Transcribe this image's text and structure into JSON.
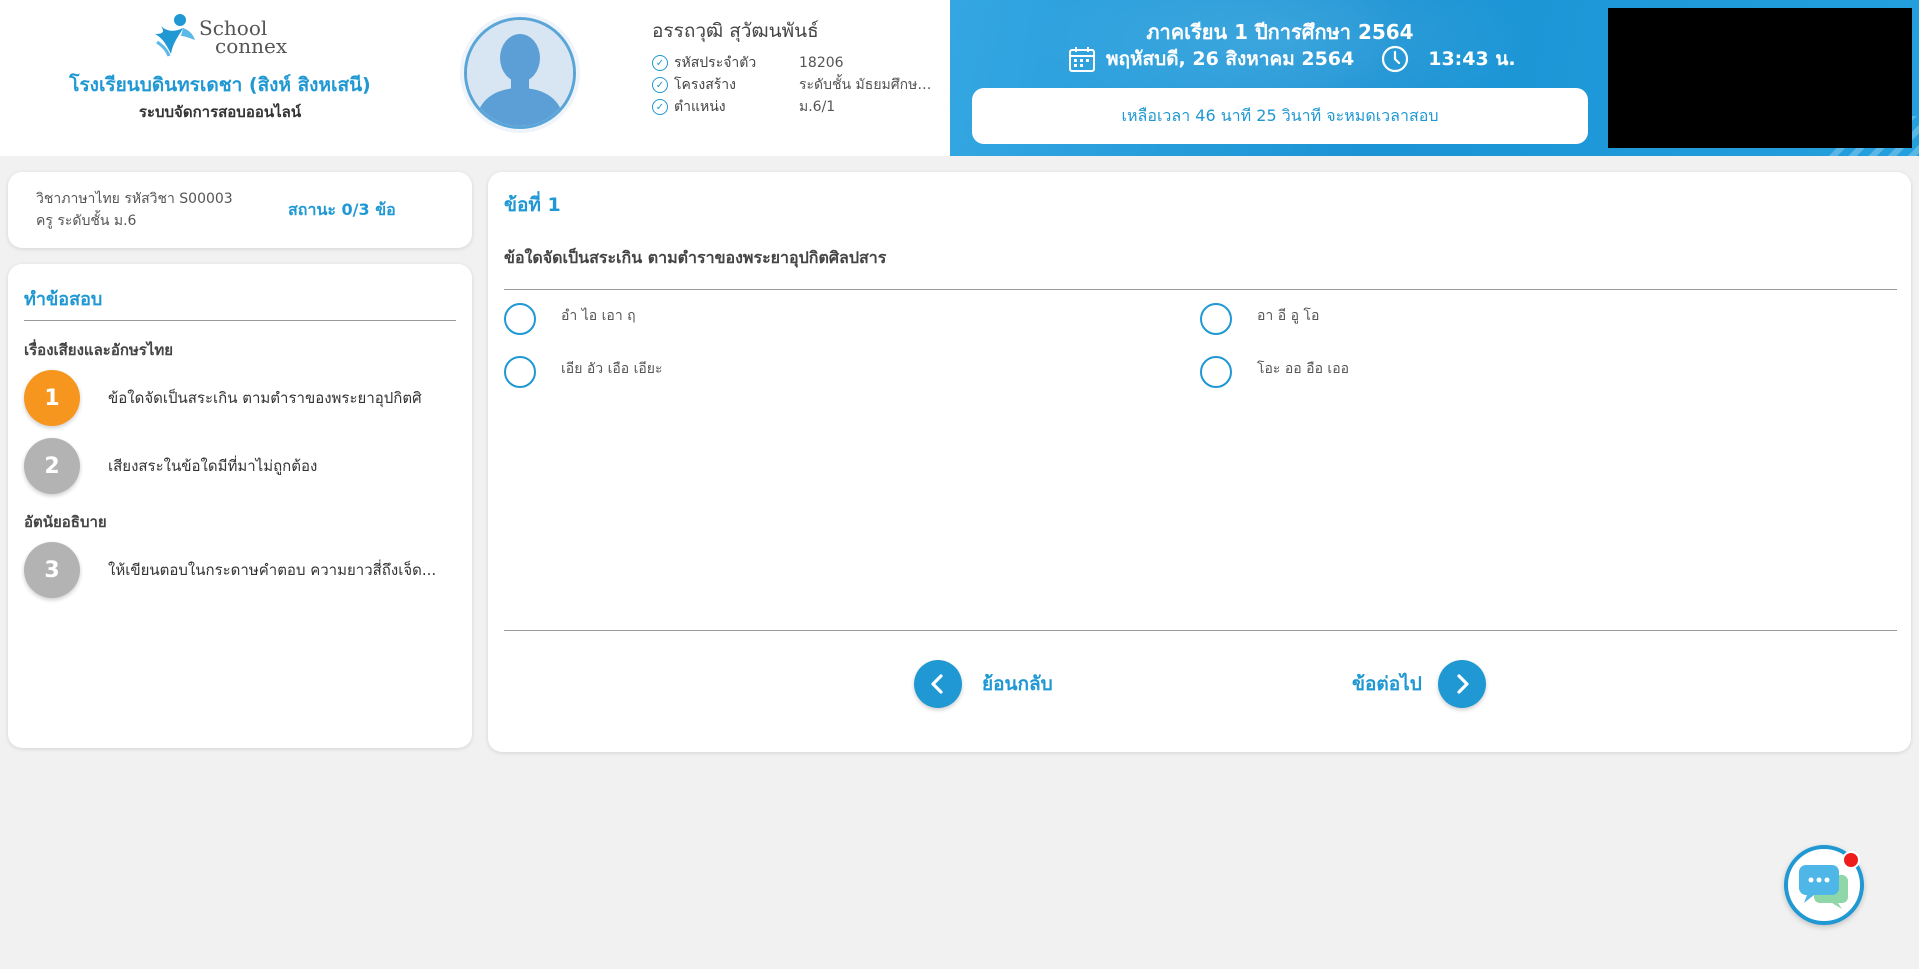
{
  "header": {
    "logo_line1": "School",
    "logo_line2": "connex",
    "school_name": "โรงเรียนบดินทรเดชา (สิงห์ สิงหเสนี)",
    "system_name": "ระบบจัดการสอบออนไลน์",
    "student_name": "อรรถวุฒิ สุวัฒนพันธ์",
    "info": [
      {
        "label": "รหัสประจำตัว",
        "value": "18206"
      },
      {
        "label": "โครงสร้าง",
        "value": "ระดับชั้น มัธยมศึกษา..."
      },
      {
        "label": "ตำแหน่ง",
        "value": "ม.6/1"
      }
    ],
    "term": "ภาคเรียน 1 ปีการศึกษา 2564",
    "date": "พฤหัสบดี, 26 สิงหาคม 2564",
    "time": "13:43 น.",
    "countdown": "เหลือเวลา 46 นาที 25 วินาที จะหมดเวลาสอบ"
  },
  "subject": {
    "line1": "วิชาภาษาไทย รหัสวิชา S00003",
    "line2": "ครู ระดับชั้น ม.6",
    "status": "สถานะ 0/3 ข้อ"
  },
  "nav": {
    "title": "ทำข้อสอบ",
    "section1": "เรื่องเสียงและอักษรไทย",
    "section2": "อัตนัยอธิบาย",
    "questions": [
      {
        "num": "1",
        "text": "ข้อใดจัดเป็นสระเกิน ตามตำราของพระยาอุปกิตศิ"
      },
      {
        "num": "2",
        "text": "เสียงสระในข้อใดมีที่มาไม่ถูกต้อง"
      },
      {
        "num": "3",
        "text": "ให้เขียนตอบในกระดาษคำตอบ ความยาวสี่ถึงเจ็ด..."
      }
    ]
  },
  "question": {
    "heading": "ข้อที่ 1",
    "prompt": "ข้อใดจัดเป็นสระเกิน ตามตำราของพระยาอุปกิตศิลปสาร",
    "choices": [
      "อำ ไอ เอา ฤ",
      "อา อี อู โอ",
      "เอีย อัว เอือ เอียะ",
      "โอะ ออ อือ เออ"
    ],
    "prev_label": "ย้อนกลับ",
    "next_label": "ข้อต่อไป"
  },
  "colors": {
    "accent": "#1f98d3",
    "active_question": "#f7961e",
    "idle_question": "#b3b3b3",
    "notification": "#ee1c1c"
  }
}
